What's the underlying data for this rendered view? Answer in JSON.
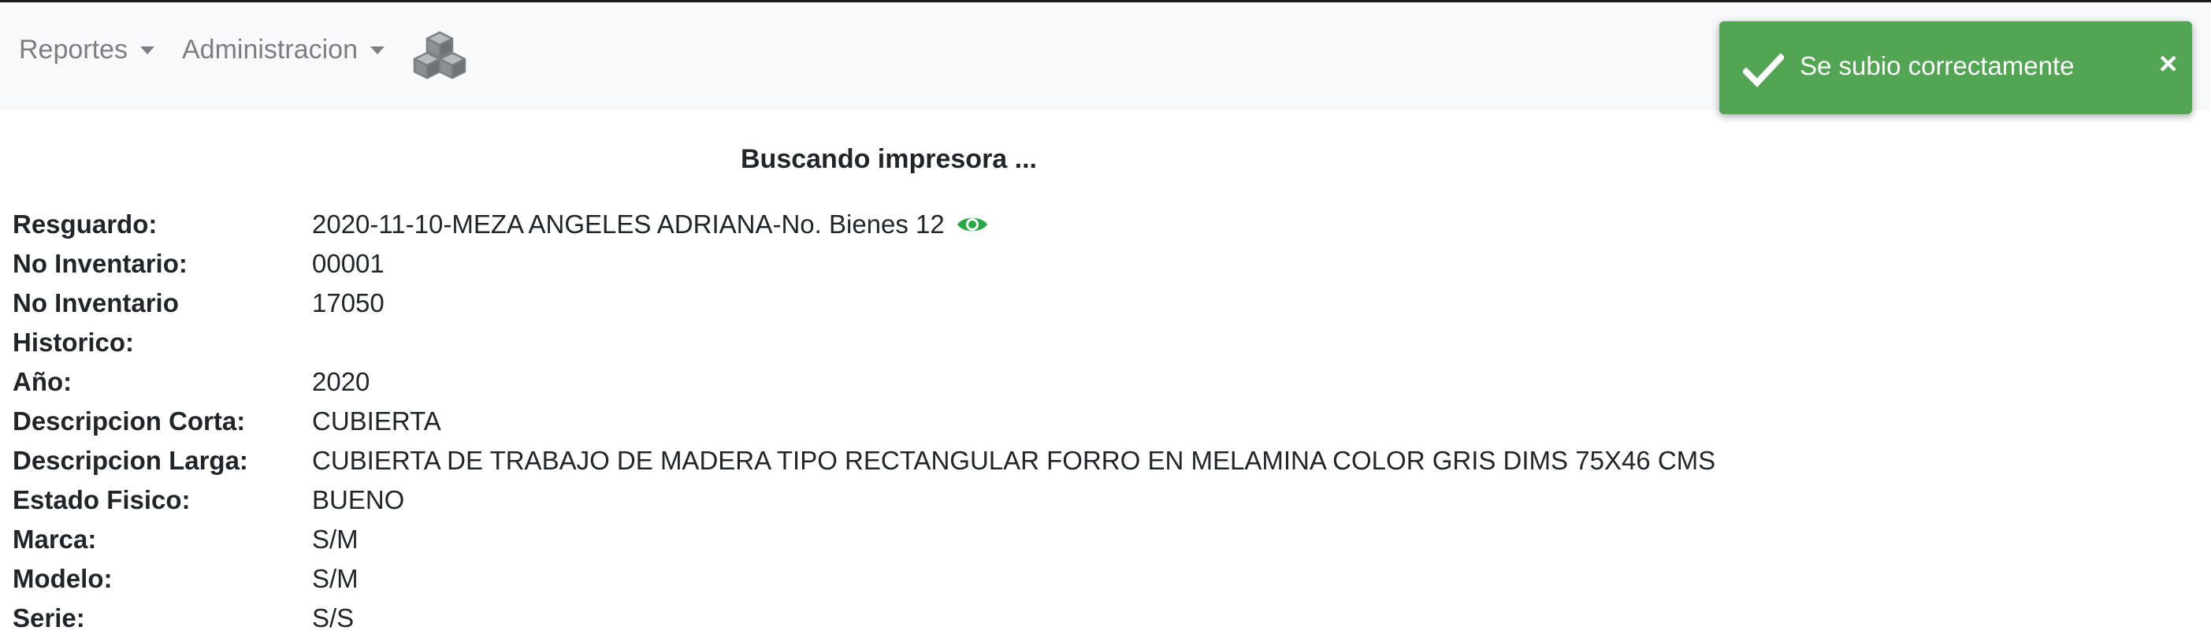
{
  "navbar": {
    "menus": [
      {
        "label": "Reportes"
      },
      {
        "label": "Administracion"
      }
    ],
    "logo_icon": "cubes-icon"
  },
  "toast": {
    "message": "Se subio correctamente",
    "close_symbol": "×",
    "icon": "check-icon",
    "color": "#52a552"
  },
  "status_text": "Buscando impresora ...",
  "details": [
    {
      "label": "Resguardo:",
      "value": "2020-11-10-MEZA ANGELES ADRIANA-No. Bienes 12"
    },
    {
      "label": "No Inventario:",
      "value": "00001"
    },
    {
      "label_line1": "No Inventario",
      "label_line2": "Historico:",
      "value": "17050"
    },
    {
      "label": "Año:",
      "value": "2020"
    },
    {
      "label": "Descripcion Corta:",
      "value": "CUBIERTA"
    },
    {
      "label": "Descripcion Larga:",
      "value": "CUBIERTA DE TRABAJO DE MADERA TIPO RECTANGULAR FORRO EN MELAMINA COLOR GRIS DIMS 75X46 CMS"
    },
    {
      "label": "Estado Fisico:",
      "value": "BUENO"
    },
    {
      "label": "Marca:",
      "value": "S/M"
    },
    {
      "label": "Modelo:",
      "value": "S/M"
    },
    {
      "label": "Serie:",
      "value": "S/S"
    }
  ],
  "accent_green": "#28a745"
}
